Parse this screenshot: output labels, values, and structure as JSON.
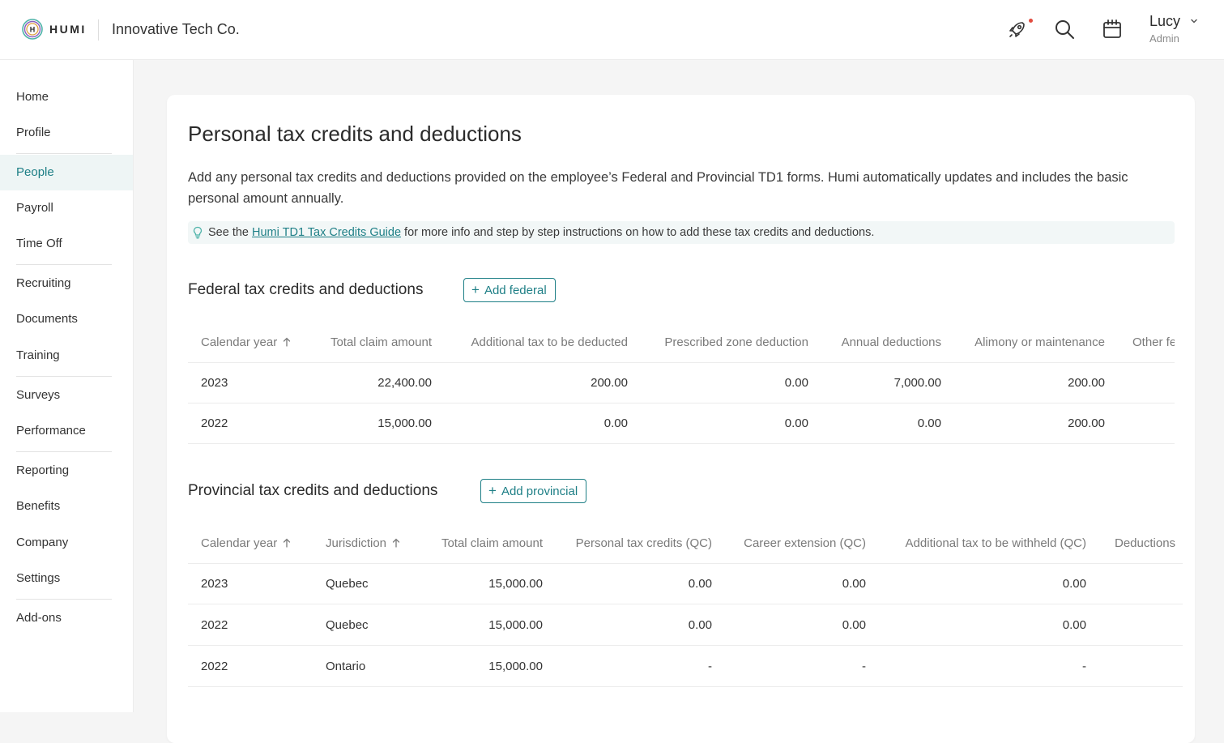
{
  "app": {
    "logo_text": "HUMI",
    "logo_badge": "H",
    "company": "Innovative Tech Co."
  },
  "user": {
    "name": "Lucy",
    "role": "Admin"
  },
  "icons": {
    "notifications": "rocket-icon",
    "search": "search-icon",
    "calendar": "calendar-icon",
    "user_menu": "chevron-down-icon"
  },
  "colors": {
    "accent": "#1e7f86",
    "notification_dot": "#e24c3f",
    "active_nav_bg": "#eef5f5"
  },
  "sidebar": {
    "items": [
      {
        "label": "Home"
      },
      {
        "label": "Profile"
      },
      {
        "label": "People",
        "active": true
      },
      {
        "label": "Payroll"
      },
      {
        "label": "Time Off"
      },
      {
        "label": "Recruiting"
      },
      {
        "label": "Documents"
      },
      {
        "label": "Training"
      },
      {
        "label": "Surveys"
      },
      {
        "label": "Performance"
      },
      {
        "label": "Reporting"
      },
      {
        "label": "Benefits"
      },
      {
        "label": "Company"
      },
      {
        "label": "Settings"
      },
      {
        "label": "Add-ons"
      }
    ]
  },
  "page": {
    "title": "Personal tax credits and deductions",
    "intro": "Add any personal tax credits and deductions provided on the employee’s Federal and Provincial TD1 forms. Humi automatically updates and includes the basic personal amount annually.",
    "tip_prefix": "See the ",
    "tip_link": "Humi TD1 Tax Credits Guide",
    "tip_suffix": " for more info and step by step instructions on how to add these tax credits and deductions."
  },
  "federal": {
    "title": "Federal tax credits and deductions",
    "add_label": "Add federal",
    "columns": [
      "Calendar year",
      "Total claim amount",
      "Additional tax to be deducted",
      "Prescribed zone deduction",
      "Annual deductions",
      "Alimony or maintenance",
      "Other fe"
    ],
    "rows": [
      {
        "year": "2023",
        "total": "22,400.00",
        "additional": "200.00",
        "zone": "0.00",
        "annual": "7,000.00",
        "alimony": "200.00"
      },
      {
        "year": "2022",
        "total": "15,000.00",
        "additional": "0.00",
        "zone": "0.00",
        "annual": "0.00",
        "alimony": "200.00"
      }
    ]
  },
  "provincial": {
    "title": "Provincial tax credits and deductions",
    "add_label": "Add provincial",
    "columns": [
      "Calendar year",
      "Jurisdiction",
      "Total claim amount",
      "Personal tax credits (QC)",
      "Career extension (QC)",
      "Additional tax to be withheld (QC)",
      "Deductions"
    ],
    "rows": [
      {
        "year": "2023",
        "jurisdiction": "Quebec",
        "total": "15,000.00",
        "personal": "0.00",
        "career": "0.00",
        "additional": "0.00"
      },
      {
        "year": "2022",
        "jurisdiction": "Quebec",
        "total": "15,000.00",
        "personal": "0.00",
        "career": "0.00",
        "additional": "0.00"
      },
      {
        "year": "2022",
        "jurisdiction": "Ontario",
        "total": "15,000.00",
        "personal": "-",
        "career": "-",
        "additional": "-"
      }
    ]
  }
}
